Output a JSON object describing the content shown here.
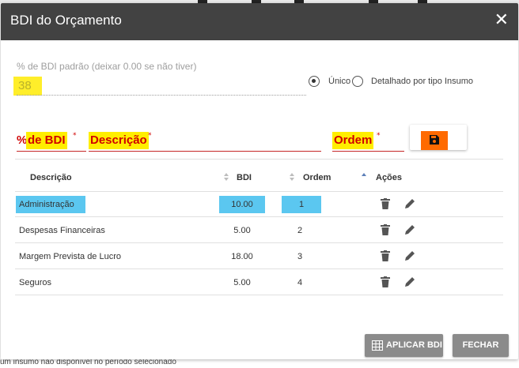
{
  "dialog": {
    "title": "BDI do Orçamento",
    "close_glyph": "✕"
  },
  "bdi_padrao": {
    "label": "% de BDI padrão (deixar 0.00 se não tiver)",
    "value": "38"
  },
  "mode": {
    "options": [
      {
        "label": "Único",
        "selected": true
      },
      {
        "label": "Detalhado por tipo Insumo",
        "selected": false
      }
    ]
  },
  "form": {
    "pct_prefix": "%",
    "pct_label": "de BDI",
    "desc_label": "Descrição",
    "ordem_label": "Ordem",
    "required_mark": "*",
    "save_icon": "floppy-disk-icon"
  },
  "table": {
    "headers": {
      "descricao": "Descrição",
      "bdi": "BDI",
      "ordem": "Ordem",
      "acoes": "Ações"
    },
    "rows": [
      {
        "descricao": "Administração",
        "bdi": "10.00",
        "ordem": "1"
      },
      {
        "descricao": "Despesas Financeiras",
        "bdi": "5.00",
        "ordem": "2"
      },
      {
        "descricao": "Margem Prevista de Lucro",
        "bdi": "18.00",
        "ordem": "3"
      },
      {
        "descricao": "Seguros",
        "bdi": "5.00",
        "ordem": "4"
      }
    ]
  },
  "footer": {
    "apply_label": "APLICAR BDI",
    "apply_icon": "table-grid-icon",
    "close_label": "FECHAR"
  },
  "background_text": "um insumo não disponível no período selecionado"
}
